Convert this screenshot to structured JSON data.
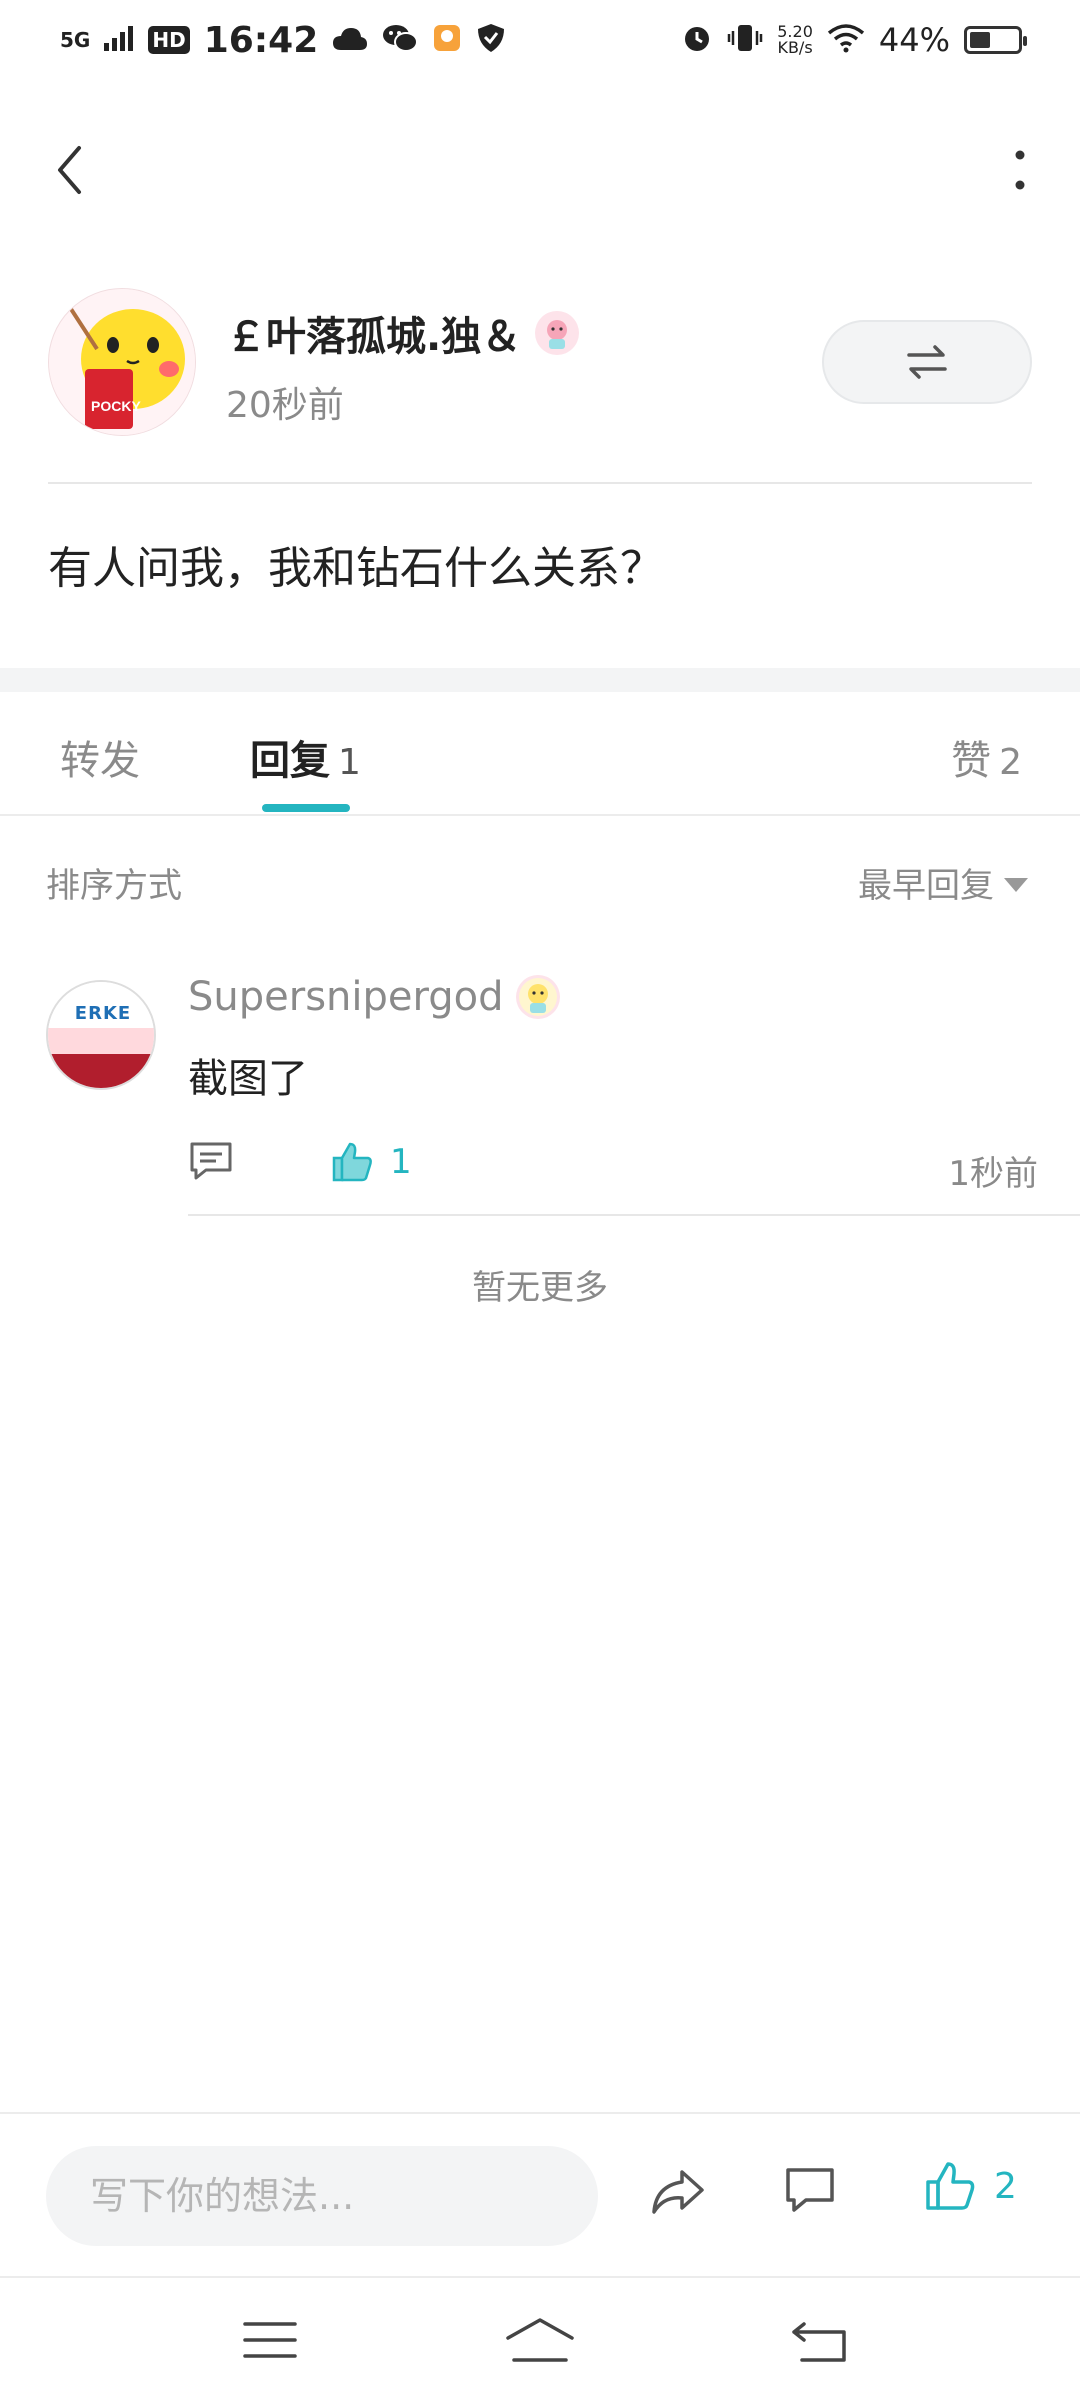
{
  "status_bar": {
    "time": "16:42",
    "network": "5G",
    "hd": "HD",
    "speed_value": "5.20",
    "speed_unit": "KB/s",
    "battery": "44%",
    "battery_level": 0.44
  },
  "nav": {
    "back_icon": "chevron-left-icon",
    "more_icon": "more-vertical-icon"
  },
  "post": {
    "author": "￡叶落孤城.独＆",
    "time": "20秒前",
    "content": "有人问我，我和钻石什么关系？",
    "switch_icon": "swap-arrows-icon"
  },
  "tabs": [
    {
      "label": "转发",
      "count": ""
    },
    {
      "label": "回复",
      "count": "1"
    },
    {
      "label": "赞",
      "count": "2"
    }
  ],
  "sort": {
    "label": "排序方式",
    "value": "最早回复"
  },
  "comments": [
    {
      "avatar_brand": "ERKE",
      "author": "Supersnipergod",
      "text": "截图了",
      "likes": "1",
      "time": "1秒前"
    }
  ],
  "no_more": "暂无更多",
  "input": {
    "placeholder": "写下你的想法..."
  },
  "bottom": {
    "like_count": "2"
  },
  "colors": {
    "accent": "#24b5c0",
    "text": "#222222",
    "muted": "#8a8a8a",
    "divider": "#e7e7e7"
  }
}
